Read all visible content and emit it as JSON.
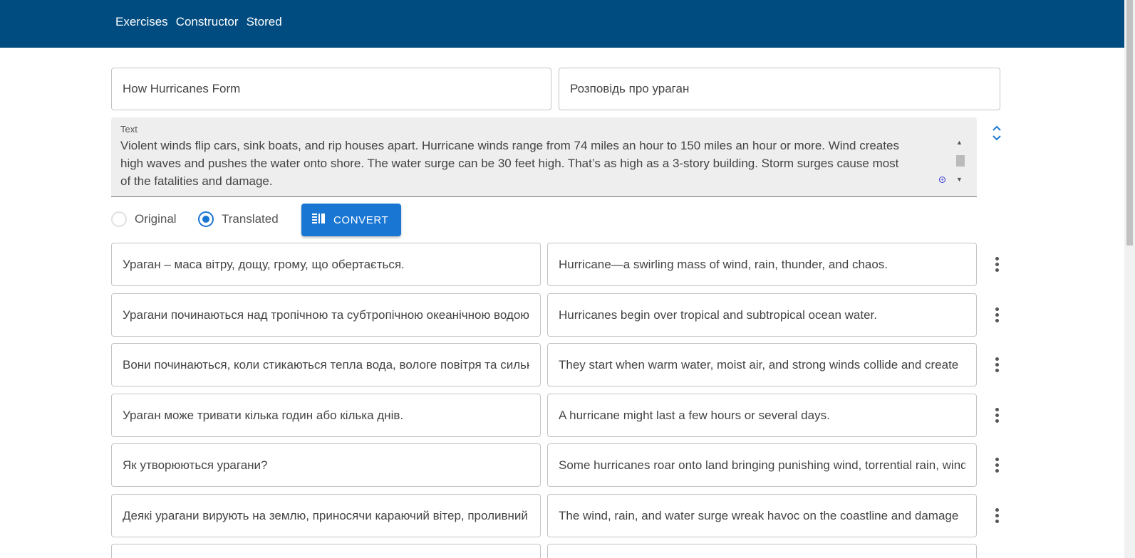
{
  "nav": {
    "items": [
      "Exercises",
      "Constructor",
      "Stored"
    ]
  },
  "header_fields": {
    "title_original": "How Hurricanes Form",
    "title_translated": "Розповідь про ураган"
  },
  "text_area": {
    "label": "Text",
    "lines": [
      "Violent winds flip cars, sink boats, and rip houses apart. Hurricane winds range from 74 miles an hour to 150 miles an hour or more. Wind creates",
      "high waves and pushes the water onto shore. The water surge can be 30 feet high. That’s as high as a 3-story building. Storm surges cause most",
      "of the fatalities and damage."
    ]
  },
  "mode": {
    "original_label": "Original",
    "translated_label": "Translated",
    "selected": "Translated"
  },
  "convert_button": {
    "label": "CONVERT",
    "icon": "list-convert-icon"
  },
  "rows": [
    {
      "left": "Ураган – маса вітру, дощу, грому, що обертається.",
      "right": "Hurricane—a swirling mass of wind, rain, thunder, and chaos."
    },
    {
      "left": "Урагани починаються над тропічною та субтропічною океанічною водою.",
      "right": "Hurricanes begin over tropical and subtropical ocean water."
    },
    {
      "left": "Вони починаються, коли стикаються тепла вода, вологе повітря та сильні вітри",
      "right": "They start when warm water, moist air, and strong winds collide and create"
    },
    {
      "left": "Ураган може тривати кілька годин або кілька днів.",
      "right": "A hurricane might last a few hours or several days."
    },
    {
      "left": "Як утворюються урагани?",
      "right": "Some hurricanes roar onto land bringing punishing wind, torrential rain, wind"
    },
    {
      "left": "Деякі урагани вирують на землю, приносячи караючий вітер, проливний дощ",
      "right": "The wind, rain, and water surge wreak havoc on the coastline and damage"
    },
    {
      "left": "",
      "right": ""
    }
  ],
  "colors": {
    "appbar": "#004b80",
    "accent": "#1976d2"
  }
}
